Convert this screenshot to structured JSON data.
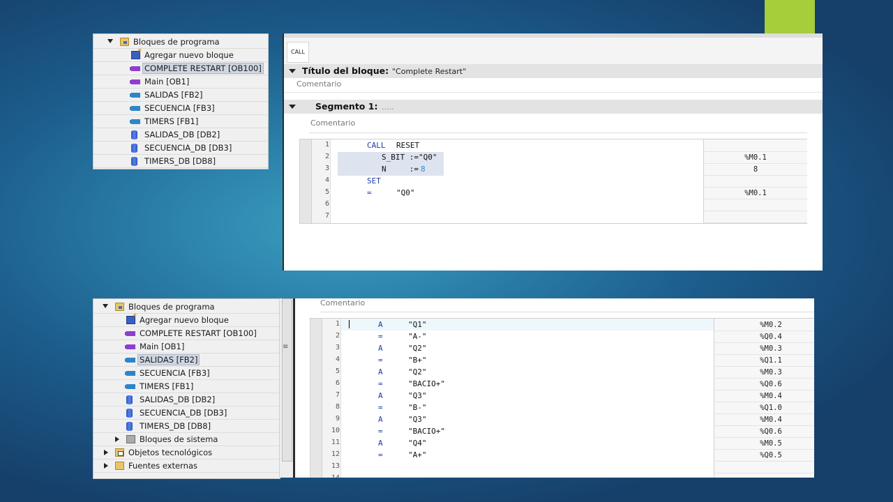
{
  "tree1": {
    "items": [
      {
        "label": "Bloques de programa",
        "type": "folder",
        "expanded": true,
        "level": 0
      },
      {
        "label": "Agregar nuevo bloque",
        "type": "add",
        "level": 1
      },
      {
        "label": "COMPLETE RESTART [OB100]",
        "type": "ob",
        "level": 1,
        "selected": true
      },
      {
        "label": "Main [OB1]",
        "type": "ob",
        "level": 1
      },
      {
        "label": "SALIDAS [FB2]",
        "type": "fb",
        "level": 1
      },
      {
        "label": "SECUENCIA [FB3]",
        "type": "fb",
        "level": 1
      },
      {
        "label": "TIMERS [FB1]",
        "type": "fb",
        "level": 1
      },
      {
        "label": "SALIDAS_DB [DB2]",
        "type": "db",
        "level": 1
      },
      {
        "label": "SECUENCIA_DB [DB3]",
        "type": "db",
        "level": 1
      },
      {
        "label": "TIMERS_DB [DB8]",
        "type": "db",
        "level": 1
      }
    ]
  },
  "tree2": {
    "items": [
      {
        "label": "Bloques de programa",
        "type": "folder",
        "expanded": true,
        "level": 0
      },
      {
        "label": "Agregar nuevo bloque",
        "type": "add",
        "level": 1
      },
      {
        "label": "COMPLETE RESTART [OB100]",
        "type": "ob",
        "level": 1
      },
      {
        "label": "Main [OB1]",
        "type": "ob",
        "level": 1
      },
      {
        "label": "SALIDAS [FB2]",
        "type": "fb",
        "level": 1,
        "selected": true
      },
      {
        "label": "SECUENCIA [FB3]",
        "type": "fb",
        "level": 1
      },
      {
        "label": "TIMERS [FB1]",
        "type": "fb",
        "level": 1
      },
      {
        "label": "SALIDAS_DB [DB2]",
        "type": "db",
        "level": 1
      },
      {
        "label": "SECUENCIA_DB [DB3]",
        "type": "db",
        "level": 1
      },
      {
        "label": "TIMERS_DB [DB8]",
        "type": "db",
        "level": 1
      },
      {
        "label": "Bloques de sistema",
        "type": "sys",
        "level": 1,
        "collapsed": true
      },
      {
        "label": "Objetos tecnológicos",
        "type": "tech",
        "level": 0,
        "collapsed": true
      },
      {
        "label": "Fuentes externas",
        "type": "ext",
        "level": 0,
        "collapsed": true
      }
    ]
  },
  "editor1": {
    "call_tab": "CALL",
    "block_title_label": "Título del bloque:",
    "block_title_value": "\"Complete Restart\"",
    "block_comment": "Comentario",
    "segment_label": "Segmento 1:",
    "segment_value": ".....",
    "segment_comment": "Comentario",
    "lines": [
      "1",
      "2",
      "3",
      "4",
      "5",
      "6",
      "7"
    ],
    "code": {
      "l1_kw": "CALL",
      "l1_op": "RESET",
      "l2_param": "S_BIT :=\"Q0\"",
      "l3_param": "N     :=",
      "l3_val": "8",
      "l4_kw": "SET",
      "l5_kw": "=",
      "l5_op": "\"Q0\""
    },
    "right": [
      "",
      "%M0.1",
      "8",
      "",
      "%M0.1",
      "",
      ""
    ]
  },
  "editor2": {
    "comment": "Comentario",
    "lines": [
      "1",
      "2",
      "3",
      "4",
      "5",
      "6",
      "7",
      "8",
      "9",
      "10",
      "11",
      "12",
      "13",
      "14"
    ],
    "rows": [
      {
        "op": "A",
        "operand": "\"Q1\"",
        "addr": "%M0.2"
      },
      {
        "op": "=",
        "operand": "\"A-\"",
        "addr": "%Q0.4"
      },
      {
        "op": "A",
        "operand": "\"Q2\"",
        "addr": "%M0.3"
      },
      {
        "op": "=",
        "operand": "\"B+\"",
        "addr": "%Q1.1"
      },
      {
        "op": "A",
        "operand": "\"Q2\"",
        "addr": "%M0.3"
      },
      {
        "op": "=",
        "operand": "\"BACIO+\"",
        "addr": "%Q0.6"
      },
      {
        "op": "A",
        "operand": "\"Q3\"",
        "addr": "%M0.4"
      },
      {
        "op": "=",
        "operand": "\"B-\"",
        "addr": "%Q1.0"
      },
      {
        "op": "A",
        "operand": "\"Q3\"",
        "addr": "%M0.4"
      },
      {
        "op": "=",
        "operand": "\"BACIO+\"",
        "addr": "%Q0.6"
      },
      {
        "op": "A",
        "operand": "\"Q4\"",
        "addr": "%M0.5"
      },
      {
        "op": "=",
        "operand": "\"A+\"",
        "addr": "%Q0.5"
      }
    ]
  },
  "colors": {
    "accent": "#a6cd3a",
    "keyword": "#1b3ca8",
    "value": "#2f8fd6"
  }
}
